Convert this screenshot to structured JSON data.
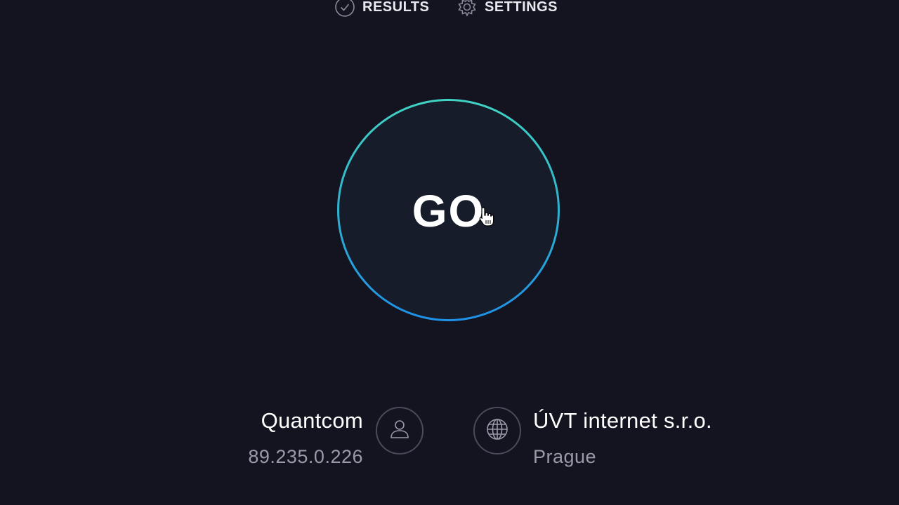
{
  "nav": {
    "results_label": "RESULTS",
    "settings_label": "SETTINGS"
  },
  "go_button": {
    "label": "GO"
  },
  "isp": {
    "name": "Quantcom",
    "ip": "89.235.0.226",
    "icon": "user-icon"
  },
  "server": {
    "name": "ÚVT internet s.r.o.",
    "location": "Prague",
    "icon": "globe-icon"
  },
  "colors": {
    "background": "#141420",
    "ring_top": "#40d3c3",
    "ring_bottom": "#1f90e6",
    "muted_text": "#9a9aa8"
  }
}
